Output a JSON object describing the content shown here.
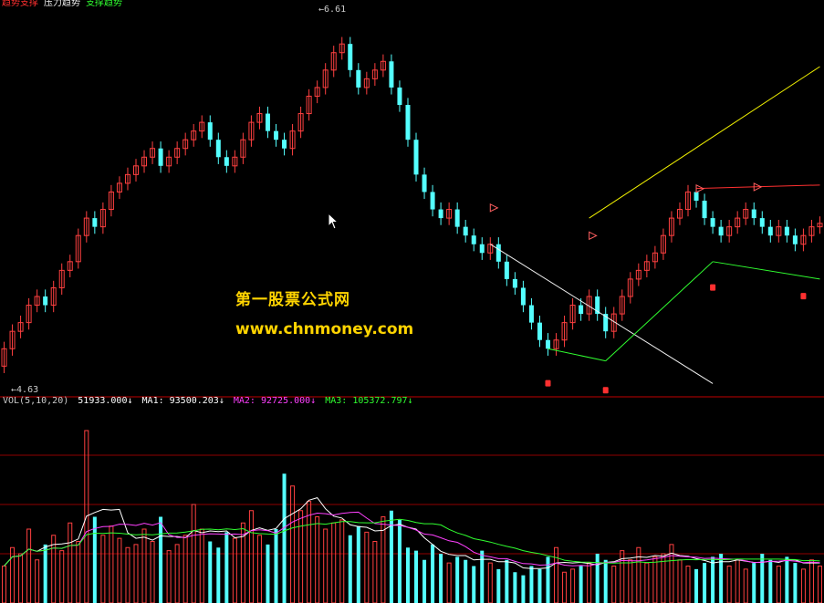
{
  "header": {
    "segments": [
      {
        "text": "趋势支撑",
        "color": "#ff3030"
      },
      {
        "text": "压力趋势",
        "color": "#f0f0f0"
      },
      {
        "text": "支撑趋势",
        "color": "#30ff30"
      }
    ]
  },
  "volume_header": {
    "name": "VOL(5,10,20)",
    "vol": "51933.000↓",
    "ma1": "MA1: 93500.203↓",
    "ma2": "MA2: 92725.000↓",
    "ma3": "MA3: 105372.797↓",
    "colors": {
      "vol": "#ffffff",
      "ma1": "#ffffff",
      "ma2": "#ff40ff",
      "ma3": "#30ff30"
    }
  },
  "price_labels": {
    "high": "6.61",
    "low": "4.63"
  },
  "watermark": {
    "line1": "第一股票公式网",
    "line2": "www.chnmoney.com"
  },
  "colors": {
    "up": "#ff4040",
    "down": "#54ffff",
    "background": "#000000",
    "border": "#c00000"
  },
  "chart_data": [
    {
      "type": "candlestick",
      "ylim": [
        4.55,
        6.75
      ],
      "series_open": [
        4.7,
        4.8,
        4.9,
        4.95,
        5.05,
        5.1,
        5.05,
        5.15,
        5.25,
        5.3,
        5.45,
        5.55,
        5.5,
        5.6,
        5.7,
        5.75,
        5.8,
        5.85,
        5.9,
        5.95,
        5.85,
        5.9,
        5.95,
        6.0,
        6.05,
        6.1,
        6.0,
        5.9,
        5.85,
        5.9,
        6.0,
        6.1,
        6.15,
        6.05,
        6.0,
        5.95,
        6.05,
        6.15,
        6.25,
        6.3,
        6.4,
        6.5,
        6.55,
        6.4,
        6.3,
        6.35,
        6.4,
        6.45,
        6.3,
        6.2,
        6.0,
        5.8,
        5.7,
        5.6,
        5.55,
        5.6,
        5.5,
        5.45,
        5.4,
        5.35,
        5.4,
        5.3,
        5.2,
        5.15,
        5.05,
        4.95,
        4.85,
        4.8,
        4.85,
        4.95,
        5.05,
        5.0,
        5.1,
        5.0,
        4.9,
        5.0,
        5.1,
        5.2,
        5.25,
        5.3,
        5.35,
        5.45,
        5.55,
        5.6,
        5.7,
        5.65,
        5.55,
        5.5,
        5.45,
        5.5,
        5.55,
        5.6,
        5.55,
        5.5,
        5.45,
        5.5,
        5.45,
        5.4,
        5.45,
        5.5
      ],
      "series_close": [
        4.8,
        4.9,
        4.95,
        5.05,
        5.1,
        5.05,
        5.15,
        5.25,
        5.3,
        5.45,
        5.55,
        5.5,
        5.6,
        5.7,
        5.75,
        5.8,
        5.85,
        5.9,
        5.95,
        5.85,
        5.9,
        5.95,
        6.0,
        6.05,
        6.1,
        6.0,
        5.9,
        5.85,
        5.9,
        6.0,
        6.1,
        6.15,
        6.05,
        6.0,
        5.95,
        6.05,
        6.15,
        6.25,
        6.3,
        6.4,
        6.5,
        6.55,
        6.4,
        6.3,
        6.35,
        6.4,
        6.45,
        6.3,
        6.2,
        6.0,
        5.8,
        5.7,
        5.6,
        5.55,
        5.6,
        5.5,
        5.45,
        5.4,
        5.35,
        5.4,
        5.3,
        5.2,
        5.15,
        5.05,
        4.95,
        4.85,
        4.8,
        4.85,
        4.95,
        5.05,
        5.0,
        5.1,
        5.0,
        4.9,
        5.0,
        5.1,
        5.2,
        5.25,
        5.3,
        5.35,
        5.45,
        5.55,
        5.6,
        5.7,
        5.65,
        5.55,
        5.5,
        5.45,
        5.5,
        5.55,
        5.6,
        5.55,
        5.5,
        5.45,
        5.5,
        5.45,
        5.4,
        5.45,
        5.5,
        5.52
      ],
      "volume": [
        60,
        90,
        80,
        120,
        70,
        95,
        110,
        85,
        130,
        100,
        280,
        140,
        110,
        125,
        105,
        90,
        95,
        120,
        100,
        140,
        85,
        95,
        110,
        160,
        120,
        100,
        90,
        115,
        105,
        130,
        150,
        110,
        95,
        120,
        210,
        190,
        150,
        165,
        140,
        120,
        130,
        135,
        110,
        125,
        115,
        100,
        140,
        150,
        135,
        90,
        85,
        70,
        95,
        80,
        65,
        75,
        70,
        60,
        85,
        65,
        55,
        70,
        50,
        45,
        60,
        55,
        75,
        90,
        50,
        55,
        60,
        65,
        80,
        70,
        60,
        85,
        70,
        90,
        65,
        75,
        80,
        95,
        70,
        60,
        55,
        65,
        75,
        80,
        60,
        70,
        55,
        65,
        80,
        70,
        60,
        75,
        65,
        55,
        70,
        60
      ],
      "vol_ylim": [
        0,
        320
      ]
    }
  ]
}
